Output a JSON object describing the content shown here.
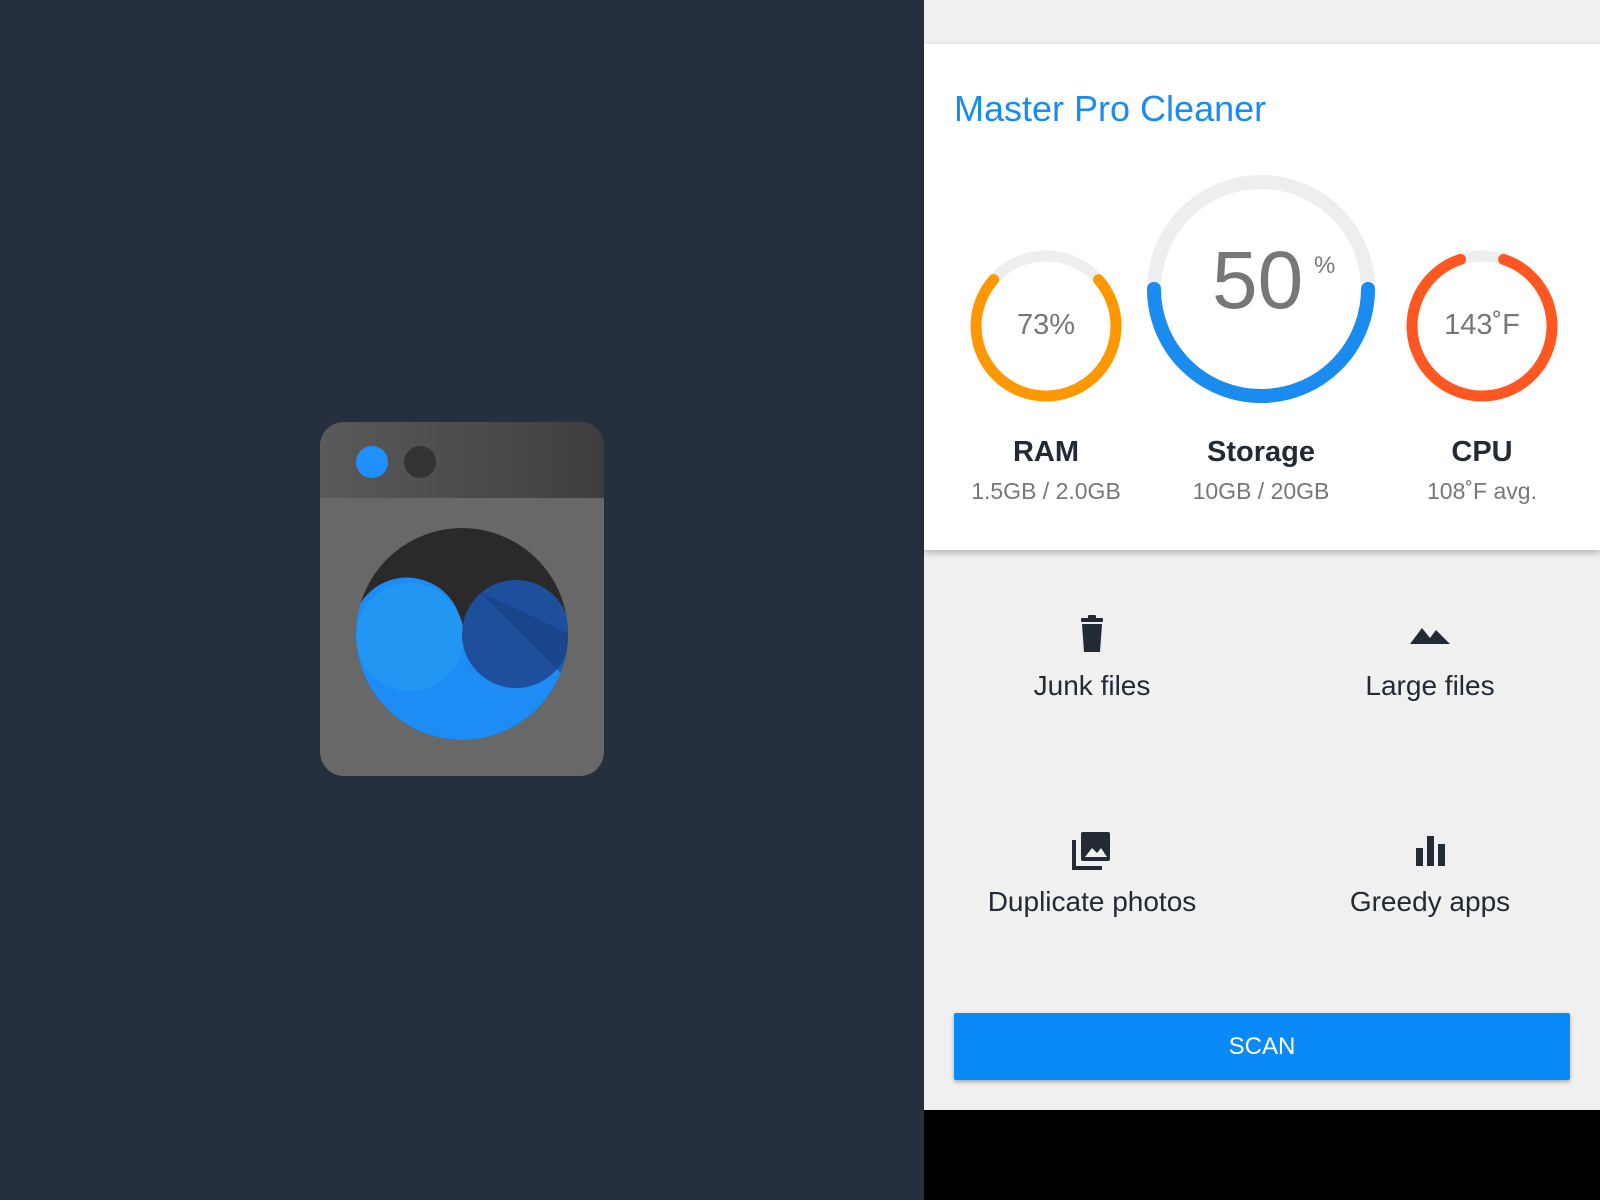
{
  "app": {
    "title": "Master Pro Cleaner"
  },
  "colors": {
    "background_left": "#262f3c",
    "accent_blue": "#1a8cf0",
    "ram_orange": "#ff9800",
    "cpu_red": "#ff5722",
    "track_gray": "#eeeeee",
    "scan_button": "#0a8af6"
  },
  "metrics": {
    "ram": {
      "value": "73%",
      "label": "RAM",
      "sub": "1.5GB / 2.0GB",
      "fraction": 0.73
    },
    "storage": {
      "value": "50",
      "unit": "%",
      "label": "Storage",
      "sub": "10GB / 20GB",
      "fraction": 0.5
    },
    "cpu": {
      "value": "143˚F",
      "label": "CPU",
      "sub": "108˚F avg.",
      "fraction": 0.9
    }
  },
  "tools": [
    {
      "label": "Junk files",
      "icon": "trash-icon"
    },
    {
      "label": "Large files",
      "icon": "mountains-icon"
    },
    {
      "label": "Duplicate photos",
      "icon": "photo-library-icon"
    },
    {
      "label": "Greedy apps",
      "icon": "bar-chart-icon"
    }
  ],
  "scan_button": {
    "label": "SCAN"
  }
}
